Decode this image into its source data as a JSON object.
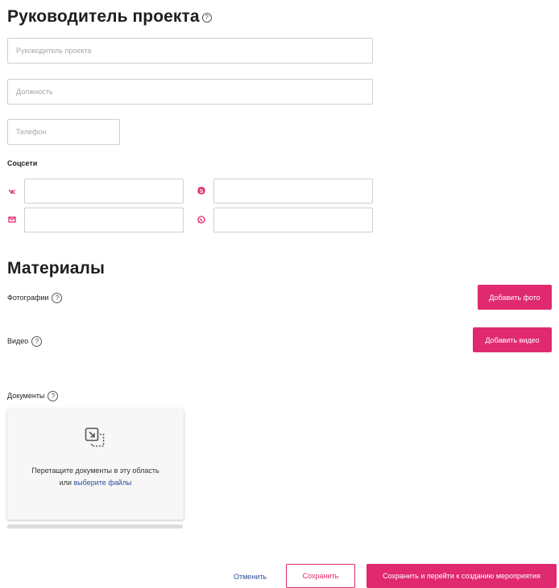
{
  "manager_section": {
    "title": "Руководитель проекта",
    "help_glyph": "?",
    "name_placeholder": "Руководитель проекта",
    "position_placeholder": "Должность",
    "phone_placeholder": "Телефон",
    "socials_label": "Соцсети",
    "socials": [
      {
        "icon": "vk-icon",
        "value": ""
      },
      {
        "icon": "skype-icon",
        "value": ""
      },
      {
        "icon": "email-icon",
        "value": ""
      },
      {
        "icon": "whatsapp-icon",
        "value": ""
      }
    ]
  },
  "materials_section": {
    "title": "Материалы",
    "photos_label": "Фотографии",
    "add_photo_label": "Добавить фото",
    "video_label": "Видео",
    "add_video_label": "Добавить видео",
    "documents_label": "Документы",
    "dropzone_text": "Перетащите документы в эту область",
    "dropzone_or": "или",
    "dropzone_link": "выберите файлы"
  },
  "footer": {
    "cancel_label": "Отменить",
    "save_label": "Сохранить",
    "save_next_label": "Сохранить и перейти к созданию мероприятия"
  },
  "colors": {
    "accent": "#e0296f",
    "link": "#2f4e9c"
  }
}
